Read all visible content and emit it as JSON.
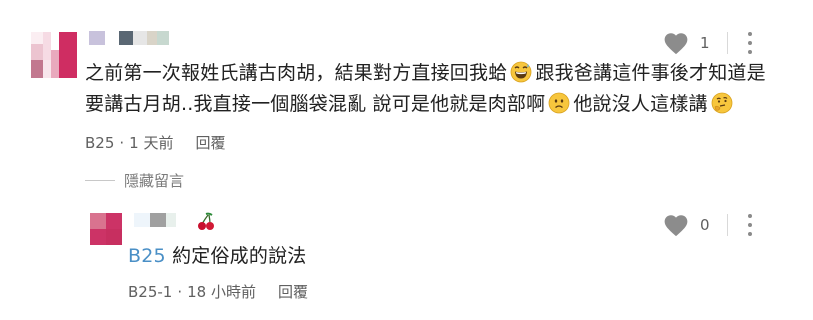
{
  "comment": {
    "text_line1": "之前第一次報姓氏講古肉胡，結果對方直接回我蛤",
    "text_line1b": "跟我爸講這件事後才知道是",
    "text_line2": "要講古月胡..我直接一個腦袋混亂 說可是他就是肉部啊",
    "text_line2b": "他說沒人這樣講",
    "emojis": [
      "grinning-sweat-emoji",
      "worried-face-emoji",
      "thinking-face-emoji"
    ],
    "author": "B25",
    "time": "1 天前",
    "reply_label": "回覆",
    "like_count": "1",
    "hide_replies_label": "隱藏留言"
  },
  "reply": {
    "mention": "B25",
    "text": "約定俗成的說法",
    "author": "B25-1",
    "time": "18 小時前",
    "reply_label": "回覆",
    "like_count": "0",
    "name_icon": "cherry-icon"
  },
  "colors": {
    "avatar1": "#cf2d62",
    "avatar2": "#cc3366",
    "mention": "#4a8fc6",
    "icon": "#8c8c8c"
  }
}
